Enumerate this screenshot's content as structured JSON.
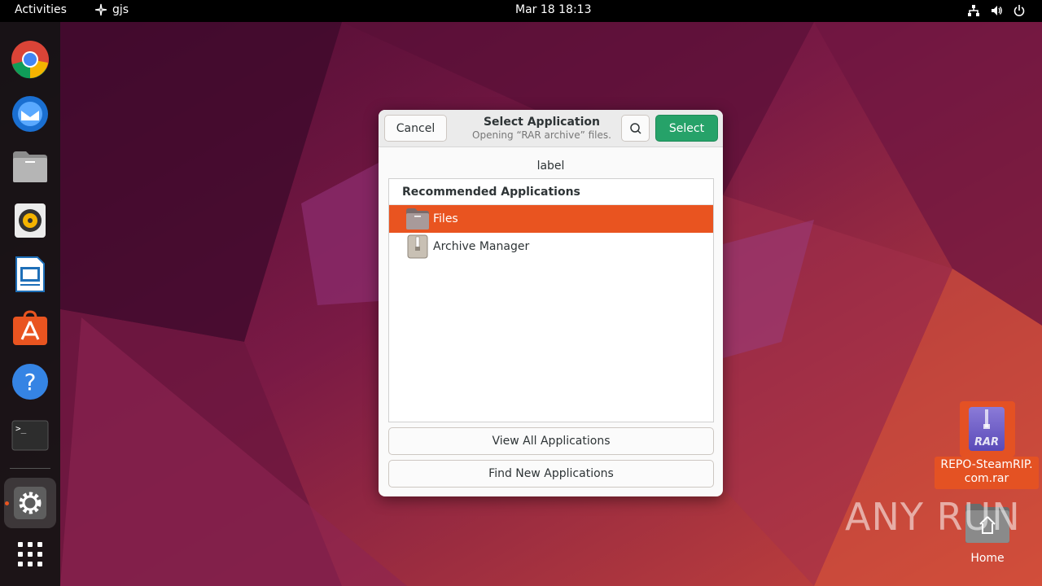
{
  "topbar": {
    "activities": "Activities",
    "app_name": "gjs",
    "clock": "Mar 18  18:13"
  },
  "dock": {
    "items": [
      "chrome-icon",
      "thunderbird-icon",
      "files-icon",
      "rhythmbox-icon",
      "libreoffice-writer-icon",
      "software-icon",
      "help-icon",
      "terminal-icon",
      "settings-icon",
      "show-apps-icon"
    ]
  },
  "dialog": {
    "cancel_label": "Cancel",
    "title": "Select Application",
    "subtitle": "Opening “RAR archive” files.",
    "select_label": "Select",
    "body_label": "label",
    "list_heading": "Recommended Applications",
    "apps": [
      {
        "name": "Files",
        "icon": "files-folder-icon",
        "selected": true
      },
      {
        "name": "Archive Manager",
        "icon": "archive-manager-icon",
        "selected": false
      }
    ],
    "view_all_label": "View All Applications",
    "find_new_label": "Find New Applications"
  },
  "desktop": {
    "rar_file_label": "REPO-SteamRIP.\ncom.rar",
    "rar_badge": "RAR",
    "home_label": "Home"
  },
  "watermark": "ANY RUN",
  "colors": {
    "accent": "#e95420",
    "select_button": "#26a269",
    "topbar": "#000000"
  }
}
